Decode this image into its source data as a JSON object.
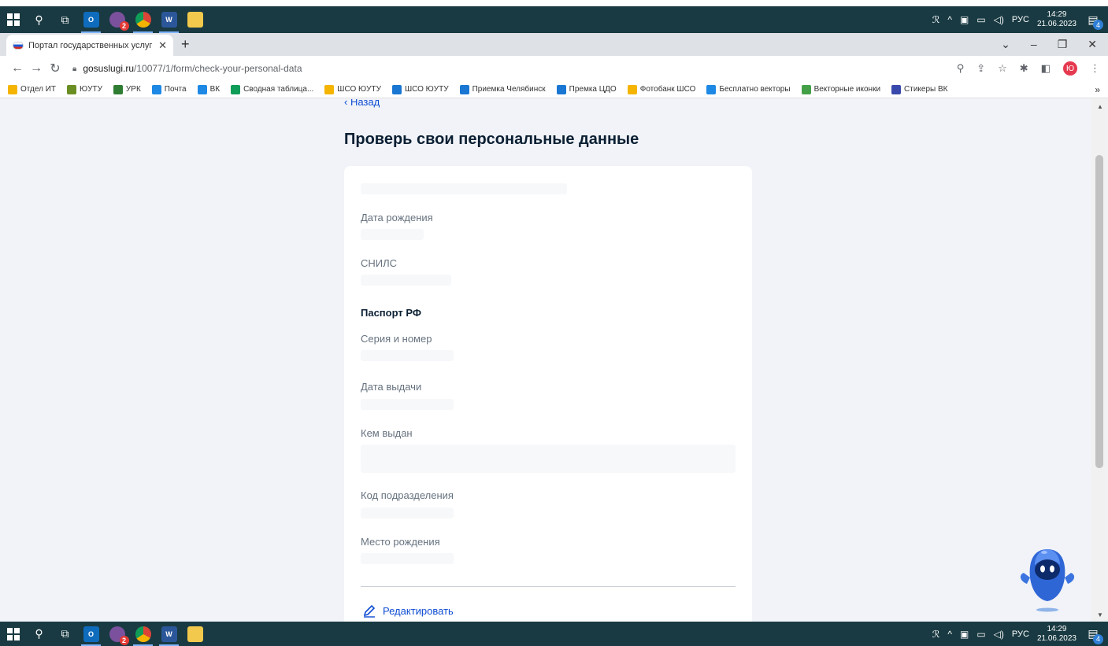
{
  "taskbar": {
    "apps": [
      {
        "name": "search-icon"
      },
      {
        "name": "task-view-icon"
      },
      {
        "name": "outlook-icon",
        "label": "O"
      },
      {
        "name": "viber-icon",
        "badge": "2"
      },
      {
        "name": "chrome-icon"
      },
      {
        "name": "word-icon",
        "label": "W"
      },
      {
        "name": "explorer-icon"
      }
    ],
    "lang": "РУС",
    "time": "14:29",
    "date": "21.06.2023",
    "notifications": "4"
  },
  "browser": {
    "tab_title": "Портал государственных услуг",
    "url_host": "gosuslugi.ru",
    "url_path": "/10077/1/form/check-your-personal-data",
    "profile_initial": "Ю",
    "bookmarks": [
      {
        "label": "Отдел ИТ",
        "color": "#f4b400"
      },
      {
        "label": "ЮУТУ",
        "color": "#6b8e23"
      },
      {
        "label": "УРК",
        "color": "#2e7d32"
      },
      {
        "label": "Почта",
        "color": "#1e88e5"
      },
      {
        "label": "ВК",
        "color": "#1e88e5"
      },
      {
        "label": "Сводная таблица...",
        "color": "#0f9d58"
      },
      {
        "label": "ШСО ЮУТУ",
        "color": "#f4b400"
      },
      {
        "label": "ШСО ЮУТУ",
        "color": "#1976d2"
      },
      {
        "label": "Приемка Челябинск",
        "color": "#1976d2"
      },
      {
        "label": "Премка ЦДО",
        "color": "#1976d2"
      },
      {
        "label": "Фотобанк ШСО",
        "color": "#f4b400"
      },
      {
        "label": "Бесплатно векторы",
        "color": "#1e88e5"
      },
      {
        "label": "Векторные иконки",
        "color": "#43a047"
      },
      {
        "label": "Стикеры ВК",
        "color": "#3949ab"
      }
    ],
    "more_bookmarks": "»"
  },
  "page": {
    "back_label": "‹ Назад",
    "title": "Проверь свои персональные данные",
    "fields": {
      "birth_date": "Дата рождения",
      "snils": "СНИЛС",
      "passport_section": "Паспорт РФ",
      "series_number": "Серия и номер",
      "issue_date": "Дата выдачи",
      "issued_by": "Кем выдан",
      "dept_code": "Код подразделения",
      "birth_place": "Место рождения"
    },
    "edit_label": "Редактировать"
  },
  "colors": {
    "link": "#0d4cd3",
    "page_bg": "#f1f3f8",
    "taskbar": "#193a42"
  }
}
